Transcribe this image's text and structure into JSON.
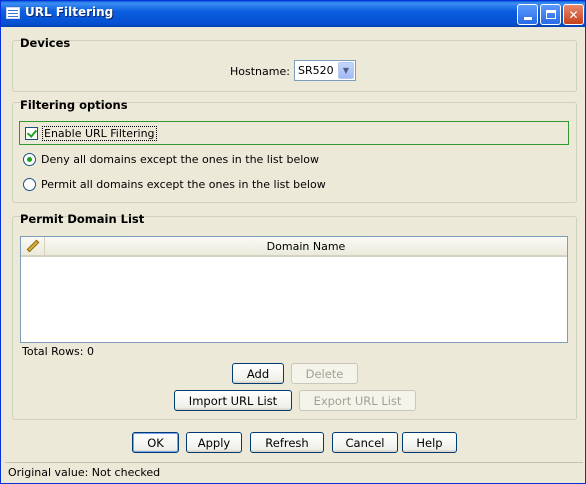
{
  "window": {
    "title": "URL Filtering"
  },
  "devices": {
    "heading": "Devices",
    "hostname_label": "Hostname:",
    "hostname_value": "SR520"
  },
  "filtering": {
    "heading": "Filtering options",
    "enable_label": "Enable URL Filtering",
    "enable_checked": true,
    "deny_label": "Deny all domains except the ones in the list below",
    "permit_label": "Permit all domains except the ones in the list below",
    "selected_mode": "deny"
  },
  "permit_list": {
    "heading": "Permit Domain List",
    "column": "Domain Name",
    "rows": [],
    "total_label": "Total Rows: 0",
    "add_label": "Add",
    "delete_label": "Delete",
    "import_label": "Import URL List",
    "export_label": "Export URL List"
  },
  "footer": {
    "ok": "OK",
    "apply": "Apply",
    "refresh": "Refresh",
    "cancel": "Cancel",
    "help": "Help"
  },
  "status": {
    "text": "Original value: Not checked"
  }
}
